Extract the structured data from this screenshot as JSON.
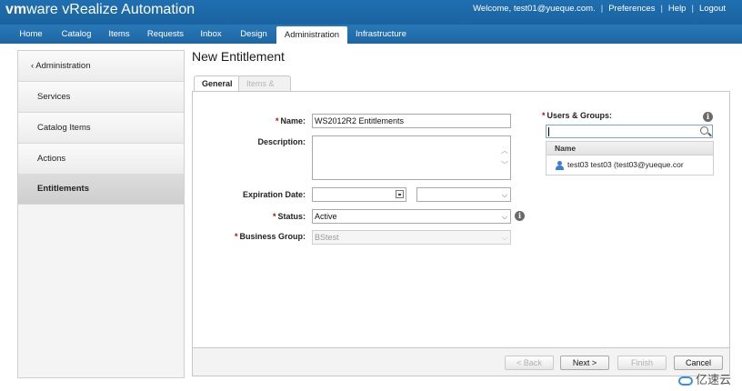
{
  "brand": {
    "logo_vm": "vm",
    "logo_ware": "ware",
    "product": " vRealize Automation"
  },
  "user_bar": {
    "welcome": "Welcome, test01@yueque.com.",
    "preferences": "Preferences",
    "help": "Help",
    "logout": "Logout",
    "separator": "|"
  },
  "nav": {
    "tabs": [
      {
        "label": "Home"
      },
      {
        "label": "Catalog"
      },
      {
        "label": "Items"
      },
      {
        "label": "Requests"
      },
      {
        "label": "Inbox"
      },
      {
        "label": "Design"
      },
      {
        "label": "Administration",
        "active": true
      },
      {
        "label": "Infrastructure"
      }
    ]
  },
  "sidebar": {
    "back_label": "Administration",
    "back_icon": "chevron-left-icon",
    "items": [
      {
        "label": "Services"
      },
      {
        "label": "Catalog Items"
      },
      {
        "label": "Actions"
      },
      {
        "label": "Entitlements",
        "active": true
      }
    ]
  },
  "page": {
    "title": "New Entitlement"
  },
  "form_tabs": [
    {
      "label": "General",
      "active": true
    },
    {
      "label": "Items & Approvals",
      "disabled": true
    }
  ],
  "form": {
    "required_marker": "*",
    "name": {
      "label": "Name:",
      "value": "WS2012R2 Entitlements"
    },
    "description": {
      "label": "Description:",
      "value": ""
    },
    "expiration": {
      "label": "Expiration Date:",
      "date_value": "",
      "time_value": ""
    },
    "status": {
      "label": "Status:",
      "value": "Active"
    },
    "business_group": {
      "label": "Business Group:",
      "value": "BStest"
    }
  },
  "users_groups": {
    "label": "Users & Groups:",
    "search_value": "",
    "column_name": "Name",
    "rows": [
      {
        "name": "test03 test03 (test03@yueque.cor"
      }
    ]
  },
  "buttons": {
    "back": "< Back",
    "next": "Next >",
    "finish": "Finish",
    "cancel": "Cancel"
  },
  "watermark": {
    "text": "亿速云"
  },
  "colors": {
    "header_blue": "#1f6fb0",
    "required_red": "#cc0000",
    "user_icon_blue": "#3b7dd8"
  }
}
